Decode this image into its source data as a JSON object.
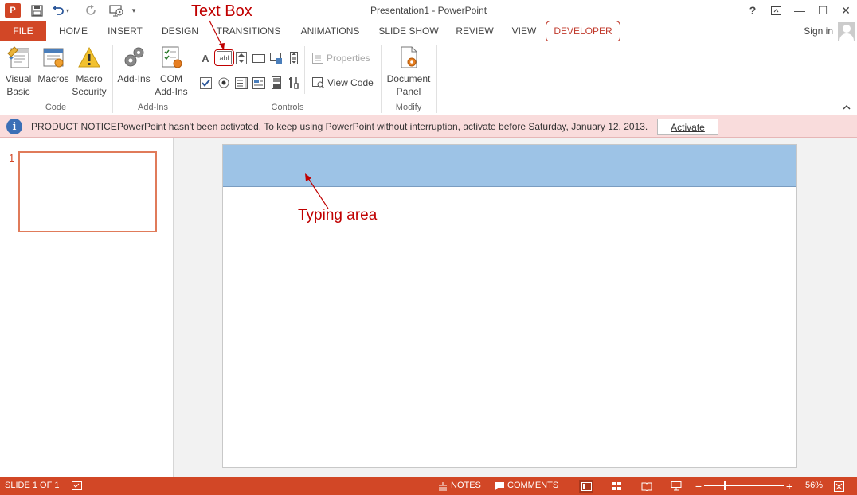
{
  "window": {
    "title": "Presentation1 - PowerPoint",
    "help": "?",
    "minimize": "—",
    "maximize": "☐",
    "close": "✕"
  },
  "quick_access": {
    "app_logo": "P",
    "icons": [
      "save-icon",
      "undo-icon",
      "redo-icon",
      "start-from-beginning-icon",
      "customize-icon"
    ]
  },
  "tabs": {
    "file": "FILE",
    "home": "HOME",
    "insert": "INSERT",
    "design": "DESIGN",
    "transitions": "TRANSITIONS",
    "animations": "ANIMATIONS",
    "slideshow": "SLIDE SHOW",
    "review": "REVIEW",
    "view": "VIEW",
    "developer": "DEVELOPER",
    "signin": "Sign in"
  },
  "ribbon": {
    "code": {
      "label": "Code",
      "visual_basic_1": "Visual",
      "visual_basic_2": "Basic",
      "macros": "Macros",
      "macro_security_1": "Macro",
      "macro_security_2": "Security"
    },
    "addins": {
      "label": "Add-Ins",
      "addins": "Add-Ins",
      "com_addins_1": "COM",
      "com_addins_2": "Add-Ins"
    },
    "controls": {
      "label": "Controls",
      "label_ctrl": "A",
      "textbox_ctrl": "abl",
      "properties": "Properties",
      "view_code": "View Code"
    },
    "modify": {
      "label": "Modify",
      "document_panel_1": "Document",
      "document_panel_2": "Panel"
    }
  },
  "notice": {
    "title": "PRODUCT NOTICE",
    "message": "PowerPoint hasn't been activated. To keep using PowerPoint without interruption, activate before Saturday, January 12, 2013.",
    "button": "Activate"
  },
  "slides": {
    "number": "1"
  },
  "annotations": {
    "text_box": "Text Box",
    "typing_area": "Typing area"
  },
  "status": {
    "slide_info": "SLIDE 1 OF 1",
    "notes": "NOTES",
    "comments": "COMMENTS",
    "zoom": "56%"
  },
  "colors": {
    "accent": "#d24726",
    "annotation": "#c00000",
    "textbox_fill": "#9dc3e6",
    "notice_bg": "#f9dcdc"
  }
}
